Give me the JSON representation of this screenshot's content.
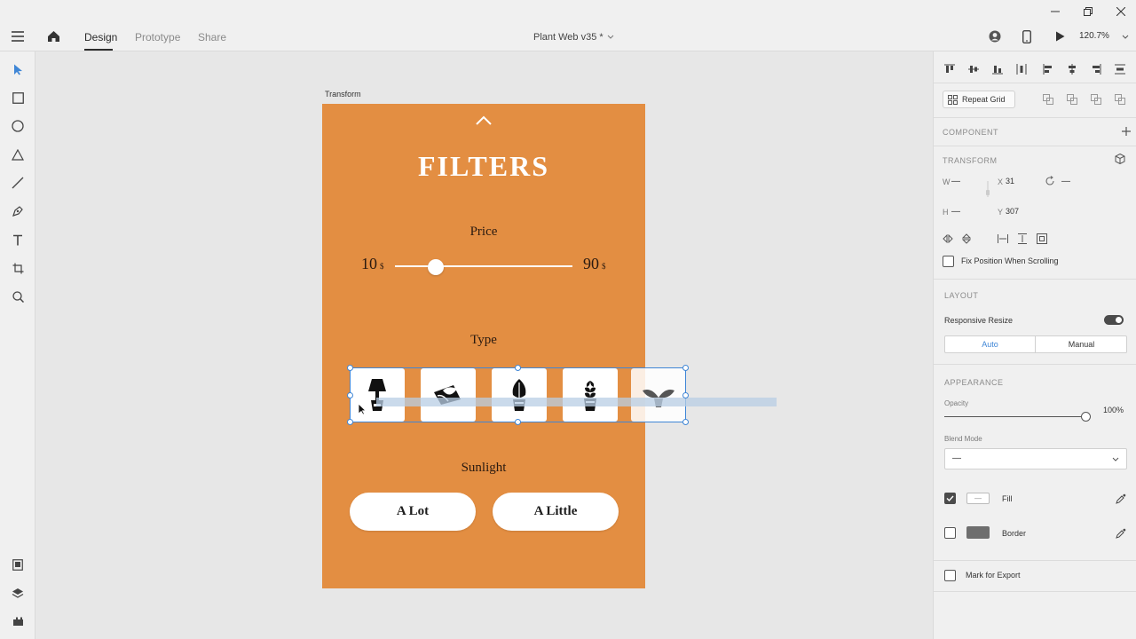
{
  "app": {
    "tabs": [
      {
        "label": "Design",
        "active": true
      },
      {
        "label": "Prototype",
        "active": false
      },
      {
        "label": "Share",
        "active": false
      }
    ],
    "document_title": "Plant Web v35 *",
    "zoom": "120.7%"
  },
  "left_tools": [
    "select-icon",
    "rectangle-icon",
    "ellipse-icon",
    "polygon-icon",
    "line-icon",
    "pen-icon",
    "text-icon",
    "artboard-icon",
    "zoom-icon"
  ],
  "canvas": {
    "artboard_label": "Transform",
    "artboard_color": "#e38e42",
    "design": {
      "title": "FILTERS",
      "price_label": "Price",
      "price_min": "10",
      "price_max": "90",
      "currency": "$",
      "slider_value_fraction": 0.23,
      "type_label": "Type",
      "plant_icons": [
        "lamp-plant-icon",
        "leaf-plant-icon",
        "tall-plant-icon",
        "potted-plant-icon",
        "sprout-plant-icon"
      ],
      "sunlight_label": "Sunlight",
      "sunlight_options": [
        "A Lot",
        "A Little"
      ]
    }
  },
  "right_panel": {
    "repeat_grid_label": "Repeat Grid",
    "component_title": "COMPONENT",
    "transform_title": "TRANSFORM",
    "w_label": "W",
    "w_value": "—",
    "h_label": "H",
    "h_value": "—",
    "x_label": "X",
    "x_value": "31",
    "y_label": "Y",
    "y_value": "307",
    "rotation_value": "—",
    "fix_position_label": "Fix Position When Scrolling",
    "layout_title": "LAYOUT",
    "responsive_resize_label": "Responsive Resize",
    "responsive_resize_on": true,
    "layout_modes": [
      "Auto",
      "Manual"
    ],
    "appearance_title": "APPEARANCE",
    "opacity_label": "Opacity",
    "opacity_value": "100%",
    "blend_mode_label": "Blend Mode",
    "blend_mode_value": "—",
    "fill_label": "Fill",
    "fill_value": "—",
    "fill_checked": true,
    "border_label": "Border",
    "border_checked": false,
    "border_color": "#6e6e6e",
    "export_label": "Mark for Export"
  },
  "colors": {
    "accent": "#3f86d6",
    "orange": "#e38e42"
  }
}
